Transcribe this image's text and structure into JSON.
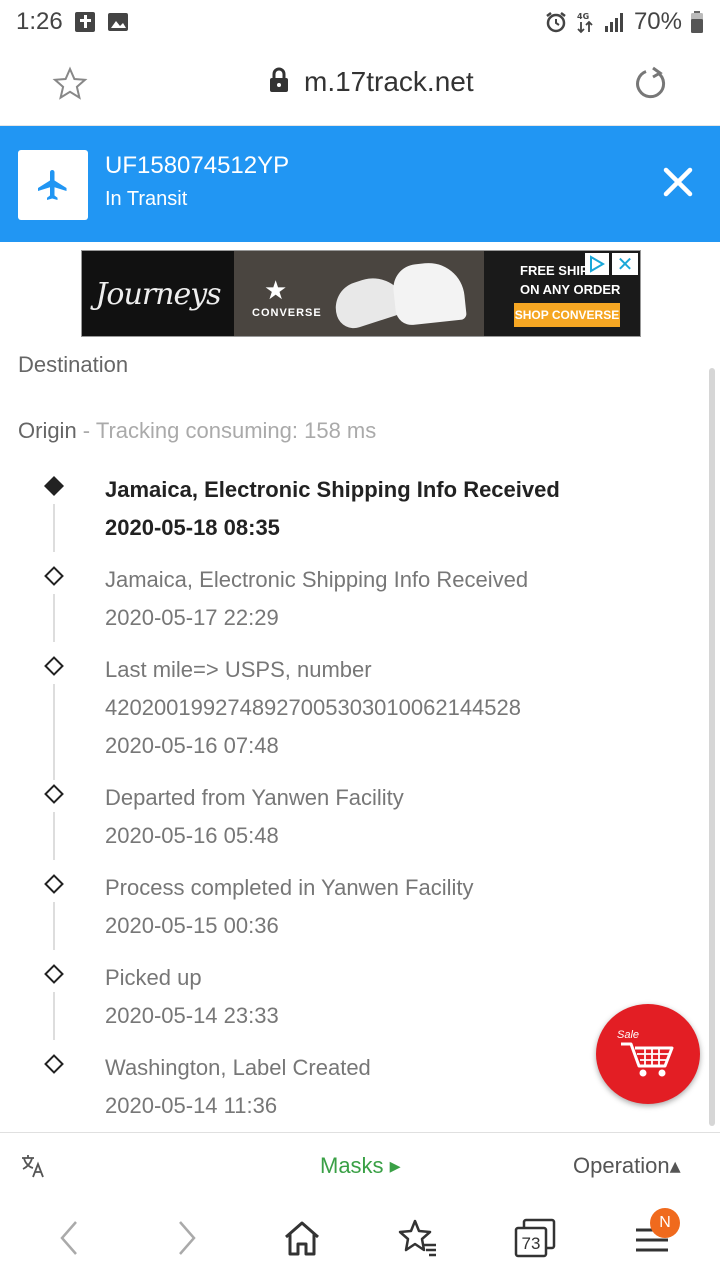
{
  "status_bar": {
    "time": "1:26",
    "battery": "70%"
  },
  "url_bar": {
    "url": "m.17track.net"
  },
  "tracking": {
    "number": "UF158074512YP",
    "status": "In Transit"
  },
  "ad": {
    "brand": "Journeys",
    "partner": "CONVERSE",
    "line1": "FREE SHIPP",
    "line2": "ON ANY ORDER",
    "cta": "SHOP CONVERSE"
  },
  "destination_label": "Destination",
  "origin": {
    "label": "Origin",
    "note": " - Tracking consuming: 158 ms"
  },
  "events": [
    {
      "lines": [
        "Jamaica, Electronic Shipping Info Received",
        "2020-05-18 08:35"
      ]
    },
    {
      "lines": [
        "Jamaica, Electronic Shipping Info Received",
        "2020-05-17 22:29"
      ]
    },
    {
      "lines": [
        "Last mile=> USPS, number",
        "420200199274892700530301006214452​8",
        "2020-05-16 07:48"
      ]
    },
    {
      "lines": [
        "Departed from Yanwen Facility",
        "2020-05-16 05:48"
      ]
    },
    {
      "lines": [
        "Process completed in Yanwen Facility",
        "2020-05-15 00:36"
      ]
    },
    {
      "lines": [
        "Picked up",
        "2020-05-14 23:33"
      ]
    },
    {
      "lines": [
        "Washington, Label Created",
        "2020-05-14 11:36"
      ]
    }
  ],
  "sale_label": "Sale",
  "toolbar": {
    "masks": "Masks ▸",
    "operation": "Operation▴"
  },
  "nav": {
    "tabs_count": "73",
    "menu_badge": "N"
  },
  "colors": {
    "header_blue": "#2196f3",
    "masks_green": "#3aa046",
    "sale_red": "#e31e24",
    "badge_orange": "#f06a1d"
  }
}
